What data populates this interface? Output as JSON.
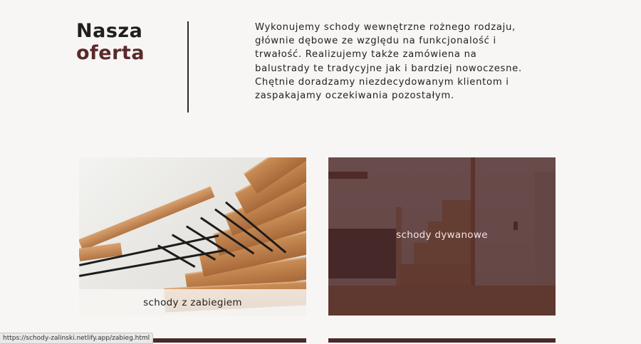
{
  "heading": {
    "line1": "Nasza",
    "line2": "oferta"
  },
  "intro": {
    "text": "Wykonujemy schody wewnętrzne rożnego rodzaju, głównie dębowe ze względu na funkcjonalość i trwałość. Realizujemy także zamówiena na balustrady te tradycyjne jak i bardziej nowoczesne. Chętnie doradzamy niezdecydowanym klientom i zaspakajamy oczekiwania pozostałym."
  },
  "offers": [
    {
      "label": "schody z zabiegiem"
    },
    {
      "label": "schody dywanowe"
    }
  ],
  "status_bar": {
    "url": "https://schody-zalinski.netlify.app/zabieg.html"
  },
  "colors": {
    "accent": "#5a2a2a",
    "overlay": "#4c2828",
    "background": "#f8f6f4"
  }
}
